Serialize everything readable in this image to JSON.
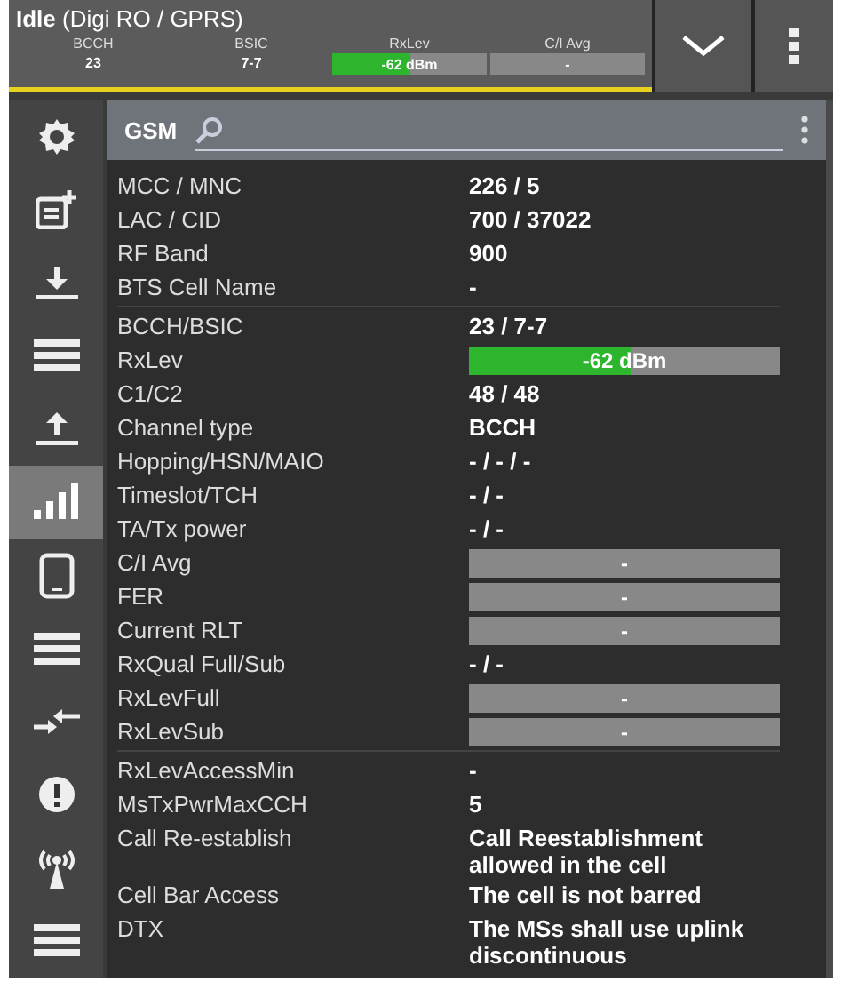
{
  "status": {
    "title": "**Idle** (Digi RO / GPRS)",
    "metrics": [
      {
        "label": "BCCH",
        "value": "23",
        "kind": "text"
      },
      {
        "label": "BSIC",
        "value": "7-7",
        "kind": "text"
      },
      {
        "label": "RxLev",
        "value": "-62 dBm",
        "kind": "bar",
        "level": 0.5
      },
      {
        "label": "C/I Avg",
        "value": "-",
        "kind": "bar"
      }
    ]
  },
  "sidebar": {
    "items": [
      {
        "kind": "gear",
        "selected": false
      },
      {
        "kind": "add-note",
        "selected": false
      },
      {
        "kind": "download",
        "selected": false
      },
      {
        "kind": "lines",
        "selected": false
      },
      {
        "kind": "upload",
        "selected": false
      },
      {
        "kind": "signal",
        "selected": true
      },
      {
        "kind": "phone",
        "selected": false
      },
      {
        "kind": "lines",
        "selected": false
      },
      {
        "kind": "arrows",
        "selected": false
      },
      {
        "kind": "alert",
        "selected": false
      },
      {
        "kind": "antenna",
        "selected": false
      },
      {
        "kind": "lines",
        "selected": false
      }
    ]
  },
  "panel": {
    "title": "GSM",
    "sections": [
      [
        {
          "label": "MCC / MNC",
          "value": "226 / 5",
          "kind": "text"
        },
        {
          "label": "LAC / CID",
          "value": "700 / 37022",
          "kind": "text"
        },
        {
          "label": "RF Band",
          "value": "900",
          "kind": "text"
        },
        {
          "label": "BTS Cell Name",
          "value": "-",
          "kind": "text"
        }
      ],
      [
        {
          "label": "BCCH/BSIC",
          "value": "23 / 7-7",
          "kind": "text"
        },
        {
          "label": "RxLev",
          "value": "-62 dBm",
          "kind": "bar",
          "level": 0.52
        },
        {
          "label": "C1/C2",
          "value": "48 / 48",
          "kind": "text"
        },
        {
          "label": "Channel type",
          "value": "BCCH",
          "kind": "text"
        },
        {
          "label": "Hopping/HSN/MAIO",
          "value": "- / - / -",
          "kind": "text"
        },
        {
          "label": "Timeslot/TCH",
          "value": "- / -",
          "kind": "text"
        },
        {
          "label": "TA/Tx power",
          "value": "- / -",
          "kind": "text"
        },
        {
          "label": "C/I Avg",
          "value": "-",
          "kind": "bar"
        },
        {
          "label": "FER",
          "value": "-",
          "kind": "bar"
        },
        {
          "label": "Current RLT",
          "value": "-",
          "kind": "bar"
        },
        {
          "label": "RxQual Full/Sub",
          "value": "- / -",
          "kind": "text"
        },
        {
          "label": "RxLevFull",
          "value": "-",
          "kind": "bar"
        },
        {
          "label": "RxLevSub",
          "value": "-",
          "kind": "bar"
        }
      ],
      [
        {
          "label": "RxLevAccessMin",
          "value": "-",
          "kind": "text"
        },
        {
          "label": "MsTxPwrMaxCCH",
          "value": "5",
          "kind": "text"
        },
        {
          "label": "Call Re-establish",
          "value": "Call Reestablishment allowed in the cell",
          "kind": "text"
        },
        {
          "label": "Cell Bar Access",
          "value": "The cell is not barred",
          "kind": "text"
        },
        {
          "label": "DTX",
          "value": "The MSs shall use uplink discontinuous",
          "kind": "text"
        }
      ]
    ]
  }
}
